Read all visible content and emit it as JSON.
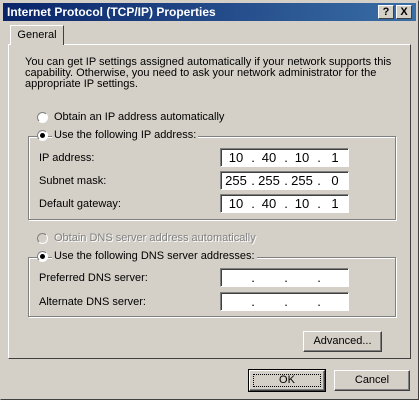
{
  "window": {
    "title": "Internet Protocol (TCP/IP) Properties",
    "help_glyph": "?",
    "close_glyph": "X"
  },
  "tabs": [
    {
      "label": "General",
      "active": true
    }
  ],
  "general": {
    "description": "You can get IP settings assigned automatically if your network supports this capability. Otherwise, you need to ask your network administrator for the appropriate IP settings.",
    "ip_mode": {
      "auto_label": "Obtain an IP address automatically",
      "manual_label": "Use the following IP address:",
      "selected": "manual"
    },
    "ip_fields": [
      {
        "label": "IP address:",
        "octets": [
          "10",
          "40",
          "10",
          "1"
        ]
      },
      {
        "label": "Subnet mask:",
        "octets": [
          "255",
          "255",
          "255",
          "0"
        ]
      },
      {
        "label": "Default gateway:",
        "octets": [
          "10",
          "40",
          "10",
          "1"
        ]
      }
    ],
    "dns_mode": {
      "auto_label": "Obtain DNS server address automatically",
      "manual_label": "Use the following DNS server addresses:",
      "selected": "manual",
      "auto_disabled": true
    },
    "dns_fields": [
      {
        "label": "Preferred DNS server:",
        "octets": [
          "",
          "",
          "",
          ""
        ]
      },
      {
        "label": "Alternate DNS server:",
        "octets": [
          "",
          "",
          "",
          ""
        ]
      }
    ],
    "advanced_label": "Advanced..."
  },
  "footer": {
    "ok_label": "OK",
    "cancel_label": "Cancel"
  },
  "colors": {
    "titlebar_start": "#0a246a",
    "titlebar_end": "#3a6ea5",
    "face": "#d4d0c8"
  }
}
